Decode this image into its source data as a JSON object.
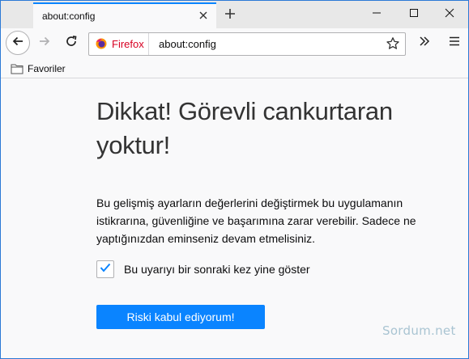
{
  "tab": {
    "title": "about:config"
  },
  "urlbar": {
    "identity_label": "Firefox",
    "url": "about:config"
  },
  "bookmarks": {
    "items": [
      {
        "label": "Favoriler",
        "icon": "folder-icon"
      }
    ]
  },
  "content": {
    "heading": "Dikkat! Görevli cankurtaran yoktur!",
    "warning": "Bu gelişmiş ayarların değerlerini değiştirmek bu uygulamanın istikrarına, güvenliğine ve başarımına zarar verebilir. Sadece ne yaptığınızdan eminseniz devam etmelisiniz.",
    "checkbox_label": "Bu uyarıyı bir sonraki kez yine göster",
    "checkbox_checked": true,
    "accept_button": "Riski kabul ediyorum!"
  },
  "watermark": "Sordum.net",
  "colors": {
    "accent": "#0a84ff",
    "firefox_label": "#d70022",
    "window_border": "#2b79d6"
  }
}
